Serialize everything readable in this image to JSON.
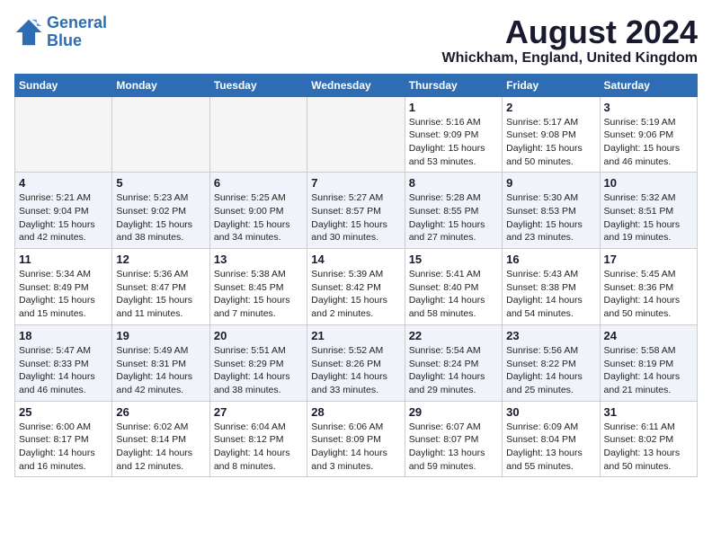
{
  "logo": {
    "line1": "General",
    "line2": "Blue"
  },
  "title": "August 2024",
  "location": "Whickham, England, United Kingdom",
  "days_of_week": [
    "Sunday",
    "Monday",
    "Tuesday",
    "Wednesday",
    "Thursday",
    "Friday",
    "Saturday"
  ],
  "weeks": [
    [
      {
        "day": "",
        "info": ""
      },
      {
        "day": "",
        "info": ""
      },
      {
        "day": "",
        "info": ""
      },
      {
        "day": "",
        "info": ""
      },
      {
        "day": "1",
        "info": "Sunrise: 5:16 AM\nSunset: 9:09 PM\nDaylight: 15 hours\nand 53 minutes."
      },
      {
        "day": "2",
        "info": "Sunrise: 5:17 AM\nSunset: 9:08 PM\nDaylight: 15 hours\nand 50 minutes."
      },
      {
        "day": "3",
        "info": "Sunrise: 5:19 AM\nSunset: 9:06 PM\nDaylight: 15 hours\nand 46 minutes."
      }
    ],
    [
      {
        "day": "4",
        "info": "Sunrise: 5:21 AM\nSunset: 9:04 PM\nDaylight: 15 hours\nand 42 minutes."
      },
      {
        "day": "5",
        "info": "Sunrise: 5:23 AM\nSunset: 9:02 PM\nDaylight: 15 hours\nand 38 minutes."
      },
      {
        "day": "6",
        "info": "Sunrise: 5:25 AM\nSunset: 9:00 PM\nDaylight: 15 hours\nand 34 minutes."
      },
      {
        "day": "7",
        "info": "Sunrise: 5:27 AM\nSunset: 8:57 PM\nDaylight: 15 hours\nand 30 minutes."
      },
      {
        "day": "8",
        "info": "Sunrise: 5:28 AM\nSunset: 8:55 PM\nDaylight: 15 hours\nand 27 minutes."
      },
      {
        "day": "9",
        "info": "Sunrise: 5:30 AM\nSunset: 8:53 PM\nDaylight: 15 hours\nand 23 minutes."
      },
      {
        "day": "10",
        "info": "Sunrise: 5:32 AM\nSunset: 8:51 PM\nDaylight: 15 hours\nand 19 minutes."
      }
    ],
    [
      {
        "day": "11",
        "info": "Sunrise: 5:34 AM\nSunset: 8:49 PM\nDaylight: 15 hours\nand 15 minutes."
      },
      {
        "day": "12",
        "info": "Sunrise: 5:36 AM\nSunset: 8:47 PM\nDaylight: 15 hours\nand 11 minutes."
      },
      {
        "day": "13",
        "info": "Sunrise: 5:38 AM\nSunset: 8:45 PM\nDaylight: 15 hours\nand 7 minutes."
      },
      {
        "day": "14",
        "info": "Sunrise: 5:39 AM\nSunset: 8:42 PM\nDaylight: 15 hours\nand 2 minutes."
      },
      {
        "day": "15",
        "info": "Sunrise: 5:41 AM\nSunset: 8:40 PM\nDaylight: 14 hours\nand 58 minutes."
      },
      {
        "day": "16",
        "info": "Sunrise: 5:43 AM\nSunset: 8:38 PM\nDaylight: 14 hours\nand 54 minutes."
      },
      {
        "day": "17",
        "info": "Sunrise: 5:45 AM\nSunset: 8:36 PM\nDaylight: 14 hours\nand 50 minutes."
      }
    ],
    [
      {
        "day": "18",
        "info": "Sunrise: 5:47 AM\nSunset: 8:33 PM\nDaylight: 14 hours\nand 46 minutes."
      },
      {
        "day": "19",
        "info": "Sunrise: 5:49 AM\nSunset: 8:31 PM\nDaylight: 14 hours\nand 42 minutes."
      },
      {
        "day": "20",
        "info": "Sunrise: 5:51 AM\nSunset: 8:29 PM\nDaylight: 14 hours\nand 38 minutes."
      },
      {
        "day": "21",
        "info": "Sunrise: 5:52 AM\nSunset: 8:26 PM\nDaylight: 14 hours\nand 33 minutes."
      },
      {
        "day": "22",
        "info": "Sunrise: 5:54 AM\nSunset: 8:24 PM\nDaylight: 14 hours\nand 29 minutes."
      },
      {
        "day": "23",
        "info": "Sunrise: 5:56 AM\nSunset: 8:22 PM\nDaylight: 14 hours\nand 25 minutes."
      },
      {
        "day": "24",
        "info": "Sunrise: 5:58 AM\nSunset: 8:19 PM\nDaylight: 14 hours\nand 21 minutes."
      }
    ],
    [
      {
        "day": "25",
        "info": "Sunrise: 6:00 AM\nSunset: 8:17 PM\nDaylight: 14 hours\nand 16 minutes."
      },
      {
        "day": "26",
        "info": "Sunrise: 6:02 AM\nSunset: 8:14 PM\nDaylight: 14 hours\nand 12 minutes."
      },
      {
        "day": "27",
        "info": "Sunrise: 6:04 AM\nSunset: 8:12 PM\nDaylight: 14 hours\nand 8 minutes."
      },
      {
        "day": "28",
        "info": "Sunrise: 6:06 AM\nSunset: 8:09 PM\nDaylight: 14 hours\nand 3 minutes."
      },
      {
        "day": "29",
        "info": "Sunrise: 6:07 AM\nSunset: 8:07 PM\nDaylight: 13 hours\nand 59 minutes."
      },
      {
        "day": "30",
        "info": "Sunrise: 6:09 AM\nSunset: 8:04 PM\nDaylight: 13 hours\nand 55 minutes."
      },
      {
        "day": "31",
        "info": "Sunrise: 6:11 AM\nSunset: 8:02 PM\nDaylight: 13 hours\nand 50 minutes."
      }
    ]
  ]
}
